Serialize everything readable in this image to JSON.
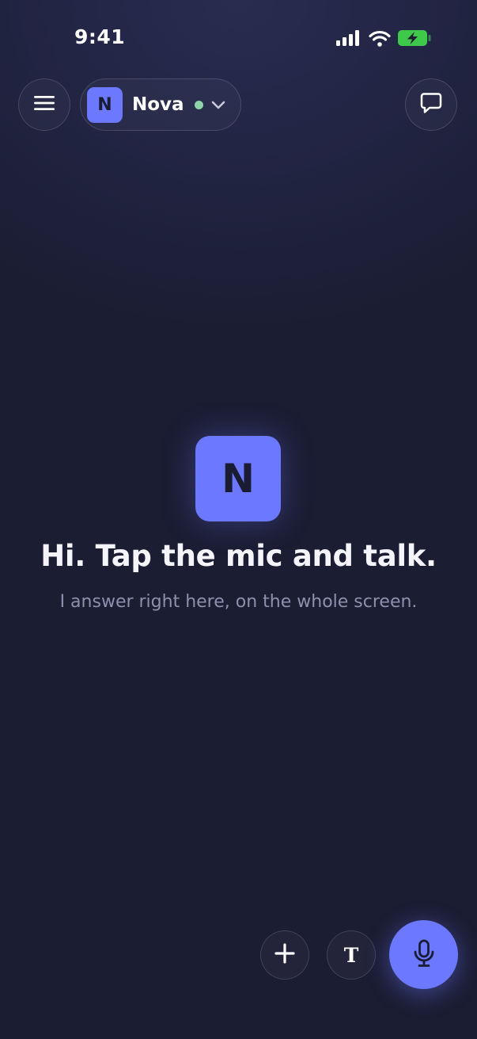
{
  "status_bar": {
    "time": "9:41",
    "icons": [
      "cellular-signal-icon",
      "wifi-icon",
      "battery-charging-icon"
    ],
    "battery_color": "#3ec94b"
  },
  "header": {
    "menu_icon": "hamburger-menu-icon",
    "agent": {
      "initial": "N",
      "name": "Nova",
      "status_color": "#8fd3a8",
      "dropdown_icon": "chevron-down-icon"
    },
    "chat_icon": "chat-bubble-icon"
  },
  "hero": {
    "logo_initial": "N",
    "title": "Hi. Tap the mic and talk.",
    "subtitle": "I answer right here, on the whole screen."
  },
  "actions": {
    "add_icon": "plus-icon",
    "text_mode_label": "T",
    "mic_icon": "microphone-icon"
  },
  "colors": {
    "accent": "#6b78ff",
    "background": "#1b1d33",
    "subtitle": "#8e90ad"
  }
}
